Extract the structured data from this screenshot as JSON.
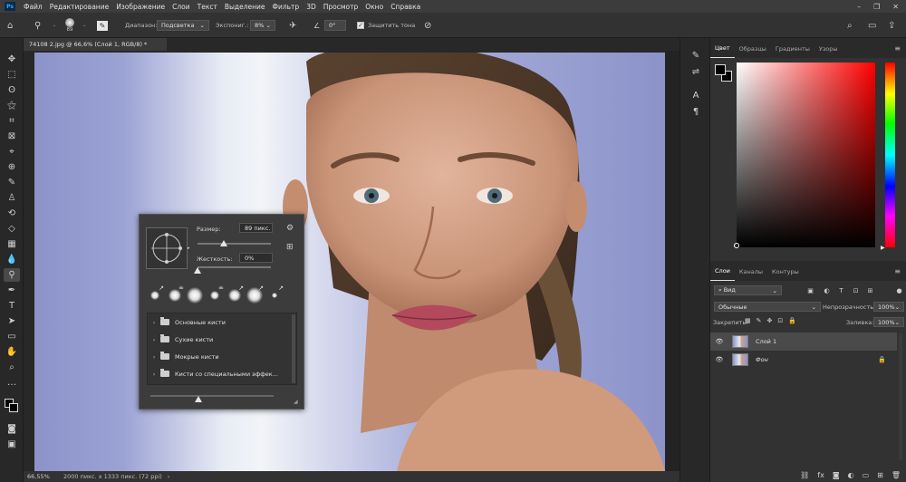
{
  "app": {
    "logo": "Ps"
  },
  "menu": [
    "Файл",
    "Редактирование",
    "Изображение",
    "Слои",
    "Текст",
    "Выделение",
    "Фильтр",
    "3D",
    "Просмотр",
    "Окно",
    "Справка"
  ],
  "options": {
    "brush_size": "89",
    "mode_label": "Диапазон:",
    "mode_value": "Подсветка",
    "exposure_label": "Экспониг.:",
    "exposure_value": "8%",
    "angle_value": "0°",
    "protect_label": "Защитить тона",
    "protect_checked": true
  },
  "document": {
    "tab_title": "74108 2.jpg @ 66,6% (Слой 1, RGB/8) *",
    "close": "×"
  },
  "status": {
    "zoom": "66,55%",
    "info": "2000 пикс. x 1333 пикс. (72 ppi)",
    "arrow": "›"
  },
  "brush_popup": {
    "size_label": "Размер:",
    "size_value": "89 пикс.",
    "size_level": 0.36,
    "hardness_label": "Жесткость:",
    "hardness_value": "0%",
    "hardness_level": 0.0,
    "groups": [
      "Основные кисти",
      "Сухие кисти",
      "Мокрые кисти",
      "Кисти со специальными эффек..."
    ]
  },
  "panels": {
    "color_tabs": [
      "Цвет",
      "Образцы",
      "Градиенты",
      "Узоры"
    ],
    "layer_tabs": [
      "Слои",
      "Каналы",
      "Контуры"
    ],
    "filter_kind": "Вид",
    "blend_mode": "Обычные",
    "opacity_label": "Непрозрачность:",
    "opacity_value": "100%",
    "lock_label": "Закрепить:",
    "fill_label": "Заливка:",
    "fill_value": "100%",
    "layers": [
      {
        "name": "Слой 1",
        "selected": true,
        "locked": false,
        "italic": false
      },
      {
        "name": "Фон",
        "selected": false,
        "locked": true,
        "italic": true
      }
    ]
  },
  "colors": {
    "foreground": "#000000",
    "background": "#000000",
    "ui_bg": "#282828",
    "photo_backdrop": "#8c93c9"
  },
  "icons": {
    "toolbar": [
      "move-icon",
      "marquee-icon",
      "lasso-icon",
      "magic-wand-icon",
      "crop-icon",
      "frame-icon",
      "eyedropper-icon",
      "healing-icon",
      "brush-icon",
      "stamp-icon",
      "history-brush-icon",
      "eraser-icon",
      "gradient-icon",
      "blur-icon",
      "dodge-icon",
      "pen-icon",
      "type-icon",
      "path-select-icon",
      "rectangle-icon",
      "hand-icon",
      "zoom-icon",
      "more-icon"
    ]
  }
}
